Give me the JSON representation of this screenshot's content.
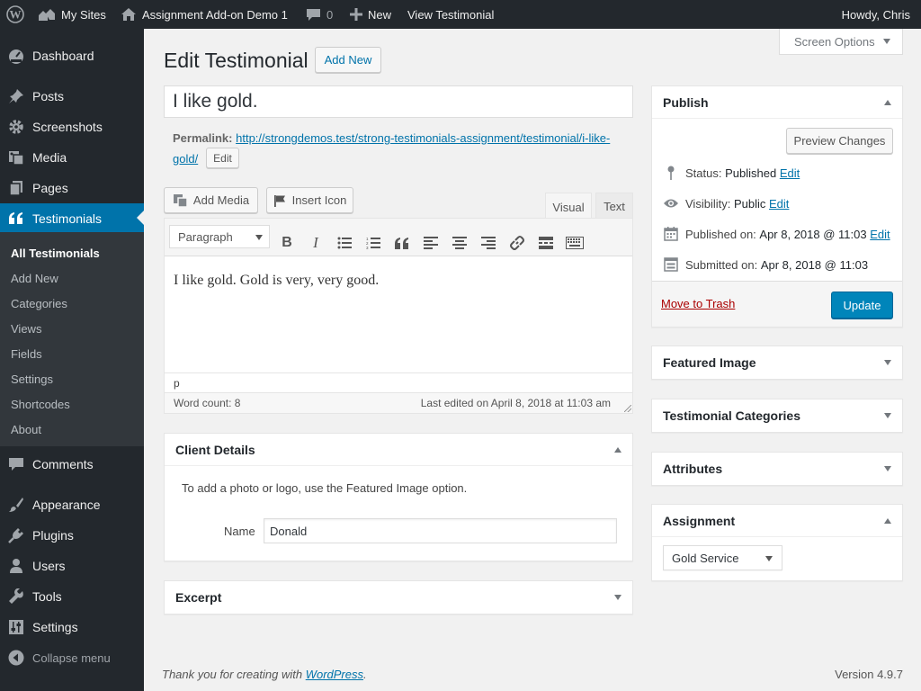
{
  "adminbar": {
    "my_sites": "My Sites",
    "site_name": "Assignment Add-on Demo 1",
    "comments_count": "0",
    "new_label": "New",
    "view_label": "View Testimonial",
    "howdy": "Howdy, Chris"
  },
  "sidebar": {
    "items": [
      {
        "label": "Dashboard",
        "icon": "dashboard-icon"
      },
      {
        "label": "Posts",
        "icon": "pin-icon"
      },
      {
        "label": "Screenshots",
        "icon": "gear-icon"
      },
      {
        "label": "Media",
        "icon": "media-icon"
      },
      {
        "label": "Pages",
        "icon": "page-icon"
      },
      {
        "label": "Testimonials",
        "icon": "quote-icon"
      },
      {
        "label": "Comments",
        "icon": "comment-icon"
      },
      {
        "label": "Appearance",
        "icon": "brush-icon"
      },
      {
        "label": "Plugins",
        "icon": "plug-icon"
      },
      {
        "label": "Users",
        "icon": "user-icon"
      },
      {
        "label": "Tools",
        "icon": "wrench-icon"
      },
      {
        "label": "Settings",
        "icon": "sliders-icon"
      }
    ],
    "submenu": [
      "All Testimonials",
      "Add New",
      "Categories",
      "Views",
      "Fields",
      "Settings",
      "Shortcodes",
      "About"
    ],
    "collapse": "Collapse menu"
  },
  "screen_options": "Screen Options",
  "page_title": "Edit Testimonial",
  "add_new": "Add New",
  "post_title": "I like gold.",
  "permalink": {
    "label": "Permalink:",
    "url_line1": "http://strongdemos.test/strong-testimonials-assignment/testimonial/i-like-",
    "url_line2": "gold/",
    "edit": "Edit"
  },
  "editor": {
    "add_media": "Add Media",
    "insert_icon": "Insert Icon",
    "tab_visual": "Visual",
    "tab_text": "Text",
    "format": "Paragraph",
    "content": "I like gold. Gold is very, very good.",
    "path": "p",
    "word_count": "Word count: 8",
    "last_edited": "Last edited on April 8, 2018 at 11:03 am"
  },
  "client_details": {
    "title": "Client Details",
    "hint": "To add a photo or logo, use the Featured Image option.",
    "name_label": "Name",
    "name_value": "Donald"
  },
  "excerpt": "Excerpt",
  "publish": {
    "title": "Publish",
    "preview": "Preview Changes",
    "status_label": "Status:",
    "status_value": "Published",
    "visibility_label": "Visibility:",
    "visibility_value": "Public",
    "published_label": "Published on:",
    "published_value": "Apr 8, 2018 @ 11:03",
    "submitted_label": "Submitted on:",
    "submitted_value": "Apr 8, 2018 @ 11:03",
    "edit": "Edit",
    "trash": "Move to Trash",
    "update": "Update"
  },
  "featured_image": "Featured Image",
  "categories": "Testimonial Categories",
  "attributes": "Attributes",
  "assignment": {
    "title": "Assignment",
    "value": "Gold Service"
  },
  "footer": {
    "thanks": "Thank you for creating with ",
    "wp_link": "WordPress",
    "period": ".",
    "version": "Version 4.9.7"
  },
  "colors": {
    "admin_dark": "#23282d",
    "accent": "#0073aa",
    "submenu": "#32373c",
    "trash": "#a00"
  }
}
